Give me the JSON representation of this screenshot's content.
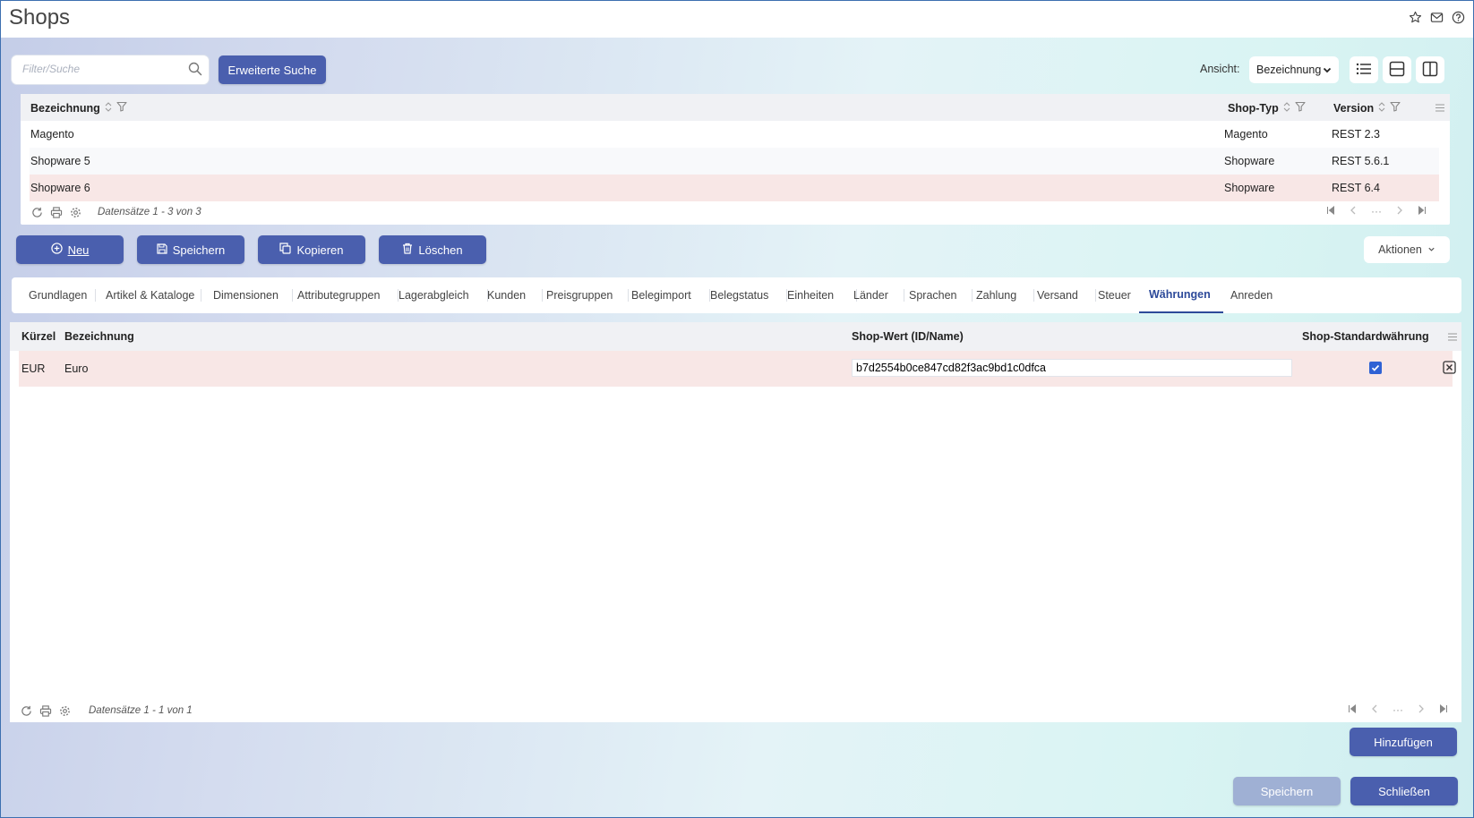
{
  "window": {
    "title": "Shops"
  },
  "search": {
    "placeholder": "Filter/Suche",
    "advanced_label": "Erweiterte Suche"
  },
  "view": {
    "label": "Ansicht:",
    "selected": "Bezeichnung"
  },
  "shops_grid": {
    "columns": {
      "name": "Bezeichnung",
      "type": "Shop-Typ",
      "version": "Version"
    },
    "rows": [
      {
        "name": "Magento",
        "type": "Magento",
        "version": "REST 2.3"
      },
      {
        "name": "Shopware 5",
        "type": "Shopware",
        "version": "REST 5.6.1"
      },
      {
        "name": "Shopware 6",
        "type": "Shopware",
        "version": "REST 6.4"
      }
    ],
    "count_text": "Datensätze 1 - 3 von 3"
  },
  "actions": {
    "new": "Neu",
    "save": "Speichern",
    "copy": "Kopieren",
    "delete": "Löschen",
    "more": "Aktionen"
  },
  "tabs": [
    "Grundlagen",
    "Artikel & Kataloge",
    "Dimensionen",
    "Attributegruppen",
    "Lagerabgleich",
    "Kunden",
    "Preisgruppen",
    "Belegimport",
    "Belegstatus",
    "Einheiten",
    "Länder",
    "Sprachen",
    "Zahlung",
    "Versand",
    "Steuer",
    "Währungen",
    "Anreden"
  ],
  "active_tab": "Währungen",
  "currency_grid": {
    "columns": {
      "code": "Kürzel",
      "name": "Bezeichnung",
      "shop_value": "Shop-Wert (ID/Name)",
      "default": "Shop-Standardwährung"
    },
    "rows": [
      {
        "code": "EUR",
        "name": "Euro",
        "shop_value": "b7d2554b0ce847cd82f3ac9bd1c0dfca",
        "default": true
      }
    ],
    "count_text": "Datensätze 1 - 1 von 1"
  },
  "buttons": {
    "add": "Hinzufügen",
    "save": "Speichern",
    "close": "Schließen"
  },
  "colors": {
    "primary": "#4a5fae",
    "selected_row": "#f8e7e6",
    "active_tab": "#2d4a9a",
    "disabled_button": "#9fb0d4"
  }
}
